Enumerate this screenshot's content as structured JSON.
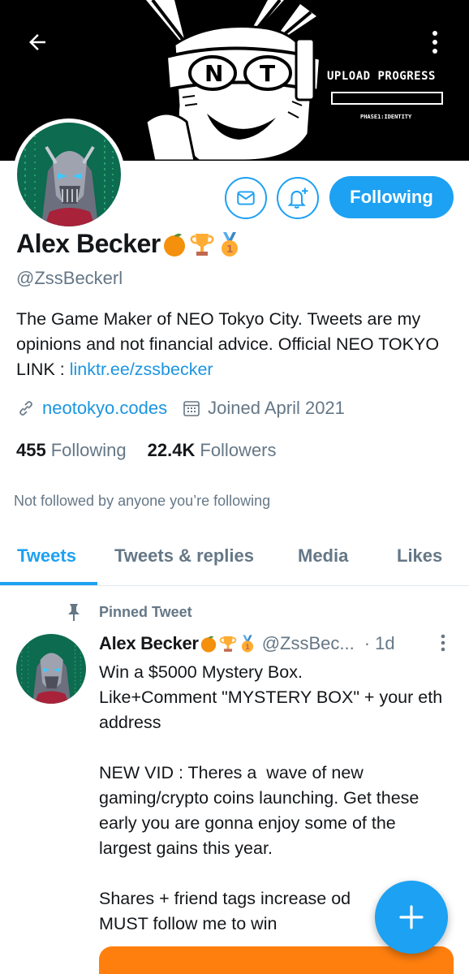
{
  "header": {
    "back_icon": "arrow-left-icon",
    "more_icon": "more-vertical-icon",
    "banner": {
      "logo_text": "NT",
      "upload_title": "UPLOAD PROGRESS",
      "upload_phase": "PHASE1:IDENTITY",
      "upload_progress": 0
    }
  },
  "profile": {
    "name": "Alex Becker",
    "badges": [
      "orange-fruit-icon",
      "trophy-icon",
      "first-place-medal-icon"
    ],
    "handle": "@ZssBeckerl",
    "bio_text": "The Game Maker of NEO Tokyo City. Tweets are my opinions and not financial advice. Official NEO TOKYO LINK : ",
    "bio_link": "linktr.ee/zssbecker",
    "website": "neotokyo.codes",
    "joined": "Joined April 2021",
    "following_count": "455",
    "following_label": "Following",
    "followers_count": "22.4K",
    "followers_label": "Followers",
    "not_followed": "Not followed by anyone you’re following"
  },
  "actions": {
    "message_icon": "envelope-icon",
    "notify_icon": "bell-plus-icon",
    "follow_label": "Following"
  },
  "tabs": [
    {
      "label": "Tweets",
      "active": true
    },
    {
      "label": "Tweets & replies",
      "active": false
    },
    {
      "label": "Media",
      "active": false
    },
    {
      "label": "Likes",
      "active": false
    }
  ],
  "pinned_tweet": {
    "pinned_label": "Pinned Tweet",
    "author_name": "Alex Becker",
    "author_handle": "@ZssBec...",
    "time": "· 1d",
    "body": "Win a $5000 Mystery Box.\nLike+Comment \"MYSTERY BOX\" + your eth address\n\nNEW VID : Theres a  wave of new gaming/crypto coins launching. Get these early you are gonna enjoy some of the largest gains this year.\n\nShares + friend tags increase od\nMUST follow me to win"
  },
  "fab": {
    "icon": "plus-icon"
  },
  "colors": {
    "accent": "#1da1f2",
    "link": "#1b95e0",
    "secondary_text": "#657786",
    "card": "#ff7f0e"
  }
}
